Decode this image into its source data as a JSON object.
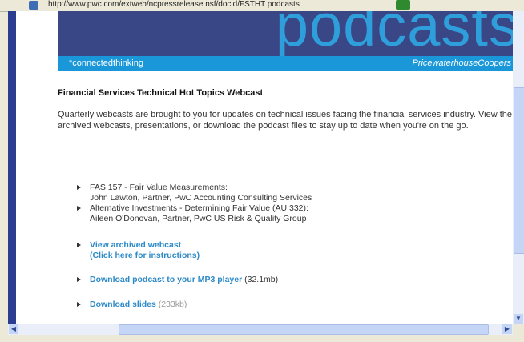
{
  "browser": {
    "address_url": "http://www.pwc.com/extweb/ncpressrelease.nsf/docid/FSTHT podcasts"
  },
  "banner": {
    "word": "podcasts",
    "tagline": "*connectedthinking",
    "brand": "PricewaterhouseCoopers",
    "colors": {
      "band": "#3a4786",
      "strip": "#1997d8",
      "word": "#2e9fda"
    }
  },
  "main": {
    "title": "Financial Services Technical Hot Topics Webcast",
    "intro": "Quarterly webcasts are brought to you for updates on technical issues facing the financial services industry.  View the archived webcasts, presentations, or download the podcast files to stay up to date when you're on the go.",
    "topics": [
      {
        "title": "FAS 157 - Fair Value Measurements:",
        "speaker": "John Lawton, Partner, PwC Accounting Consulting Services"
      },
      {
        "title": "Alternative Investments - Determining Fair Value (AU 332):",
        "speaker": "Aileen O'Donovan, Partner, PwC US Risk & Quality Group"
      }
    ],
    "links": {
      "archived_webcast": "View archived webcast",
      "instructions": "(Click here for instructions)",
      "podcast": "Download podcast to your MP3 player",
      "podcast_size": "(32.1mb)",
      "slides": "Download slides",
      "slides_size": "(233kb)"
    }
  },
  "colors": {
    "link": "#2d8ac8",
    "text": "#333333"
  }
}
